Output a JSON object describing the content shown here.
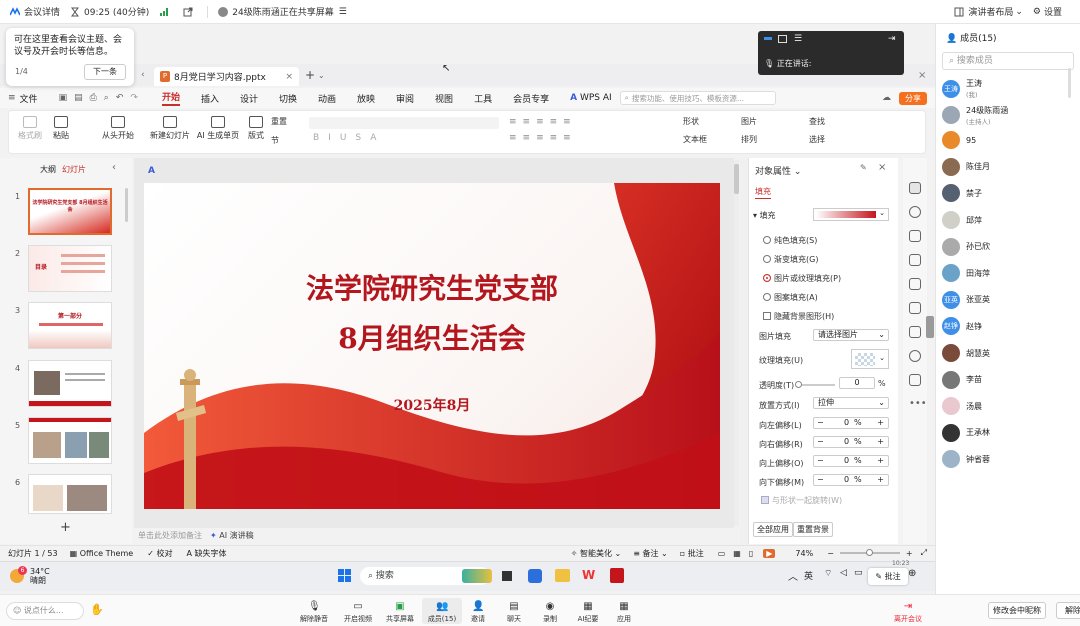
{
  "meeting_top": {
    "meeting_details": "会议详情",
    "timer": "09:25 (40分钟)",
    "share_status": "24级陈雨涵正在共享屏幕",
    "presenter_layout": "演讲者布局",
    "settings": "设置"
  },
  "tip": {
    "text": "可在这里查看会议主题、会议号及开会时长等信息。",
    "page": "1/4",
    "next": "下一条"
  },
  "floatbar": {
    "speaking": "正在讲话:"
  },
  "wps": {
    "doc_tab": "8月党日学习内容.pptx",
    "ppt_icon": "P",
    "menu": [
      "文件",
      "开始",
      "插入",
      "设计",
      "切换",
      "动画",
      "放映",
      "审阅",
      "视图",
      "工具",
      "会员专享",
      "WPS AI"
    ],
    "active_menu": "开始",
    "search_placeholder": "搜索功能、使用技巧、模板资源...",
    "share_btn": "分享",
    "ribbon": {
      "format_painter": "格式刷",
      "paste": "粘贴",
      "from_start": "从头开始",
      "new_slide": "新建幻灯片",
      "ai_slide": "AI 生成单页",
      "layout": "版式",
      "section": "节",
      "reset": "重置",
      "shape": "形状",
      "image": "图片",
      "textbox": "文本框",
      "arrange": "排列",
      "find": "查找",
      "select": "选择"
    },
    "left_tabs": {
      "outline": "大纲",
      "slides": "幻灯片"
    },
    "thumbs": [
      {
        "num": "1",
        "title": "法学院研究生党支部 8月组织生活会"
      },
      {
        "num": "2",
        "title": "目录"
      },
      {
        "num": "3",
        "title": "第一部分"
      },
      {
        "num": "4",
        "title": ""
      },
      {
        "num": "5",
        "title": ""
      },
      {
        "num": "6",
        "title": ""
      }
    ],
    "add_slide": "+",
    "slide": {
      "line1": "法学院研究生党支部",
      "line2": "8月组织生活会",
      "date": "2025年8月"
    },
    "notes_placeholder": "单击此处添加备注",
    "ai_speech": "AI 演讲稿",
    "props": {
      "header": "对象属性",
      "tab_fill": "填充",
      "fill_label": "填充",
      "options": [
        "纯色填充(S)",
        "渐变填充(G)",
        "图片或纹理填充(P)",
        "图案填充(A)"
      ],
      "hide_bg": "隐藏背景图形(H)",
      "picture_fill": "图片填充",
      "picture_fill_value": "请选择图片",
      "texture_fill": "纹理填充(U)",
      "transparency": "透明度(T)",
      "transparency_value": "0",
      "transparency_unit": "%",
      "placement": "放置方式(I)",
      "placement_value": "拉伸",
      "offsets": [
        {
          "label": "向左偏移(L)",
          "value": "0",
          "unit": "%"
        },
        {
          "label": "向右偏移(R)",
          "value": "0",
          "unit": "%"
        },
        {
          "label": "向上偏移(O)",
          "value": "0",
          "unit": "%"
        },
        {
          "label": "向下偏移(M)",
          "value": "0",
          "unit": "%"
        }
      ],
      "rotate_with_shape": "与形状一起旋转(W)",
      "apply_all": "全部应用",
      "reset_bg": "重置背景"
    },
    "status": {
      "slide_pos": "幻灯片 1 / 53",
      "theme": "Office Theme",
      "proofread": "校对",
      "missing_font": "缺失字体",
      "beautify": "智能美化",
      "notes": "备注",
      "comment": "批注",
      "zoom": "74%"
    }
  },
  "taskbar": {
    "temp": "34°C",
    "weather": "晴朗",
    "weather_badge": "6",
    "search": "搜索",
    "ime": "英",
    "annotate": "批注",
    "time": "10:23"
  },
  "meeting_bottom": {
    "say_something": "说点什么...",
    "buttons": [
      "解除静音",
      "开启视频",
      "共享屏幕",
      "成员(15)",
      "邀请",
      "聊天",
      "录制",
      "AI纪要",
      "应用"
    ],
    "leave": "离开会议",
    "edit_name": "修改会中昵称",
    "unmute": "解除"
  },
  "members": {
    "title": "成员(15)",
    "search_placeholder": "搜索成员",
    "list": [
      {
        "avatar": "王涛",
        "name": "王涛",
        "sub": "(我)",
        "color": "#3d8fe8"
      },
      {
        "avatar": "",
        "name": "24级陈雨涵",
        "sub": "(主持人)",
        "color": "#9ba7b5"
      },
      {
        "avatar": "",
        "name": "95",
        "sub": "",
        "color": "#e88a2a"
      },
      {
        "avatar": "",
        "name": "陈佳月",
        "sub": "",
        "color": "#8a6a50"
      },
      {
        "avatar": "",
        "name": "禁子",
        "sub": "",
        "color": "#556070"
      },
      {
        "avatar": "",
        "name": "邱萍",
        "sub": "",
        "color": "#d0cfc8"
      },
      {
        "avatar": "",
        "name": "孙已欣",
        "sub": "",
        "color": "#aaa"
      },
      {
        "avatar": "",
        "name": "田海萍",
        "sub": "",
        "color": "#6aa2c8"
      },
      {
        "avatar": "亚英",
        "name": "张亚英",
        "sub": "",
        "color": "#3d8fe8"
      },
      {
        "avatar": "赵铮",
        "name": "赵铮",
        "sub": "",
        "color": "#3d8fe8"
      },
      {
        "avatar": "",
        "name": "胡慧英",
        "sub": "",
        "color": "#7a4a3a"
      },
      {
        "avatar": "",
        "name": "李苗",
        "sub": "",
        "color": "#777"
      },
      {
        "avatar": "",
        "name": "汤晨",
        "sub": "",
        "color": "#e9c8d0"
      },
      {
        "avatar": "",
        "name": "王承林",
        "sub": "",
        "color": "#333"
      },
      {
        "avatar": "",
        "name": "钟省蓉",
        "sub": "",
        "color": "#9db4c8"
      }
    ]
  },
  "colors": {
    "accent": "#c8302a",
    "slide_red": "#c4151c",
    "member_blue": "#3d8fe8"
  }
}
